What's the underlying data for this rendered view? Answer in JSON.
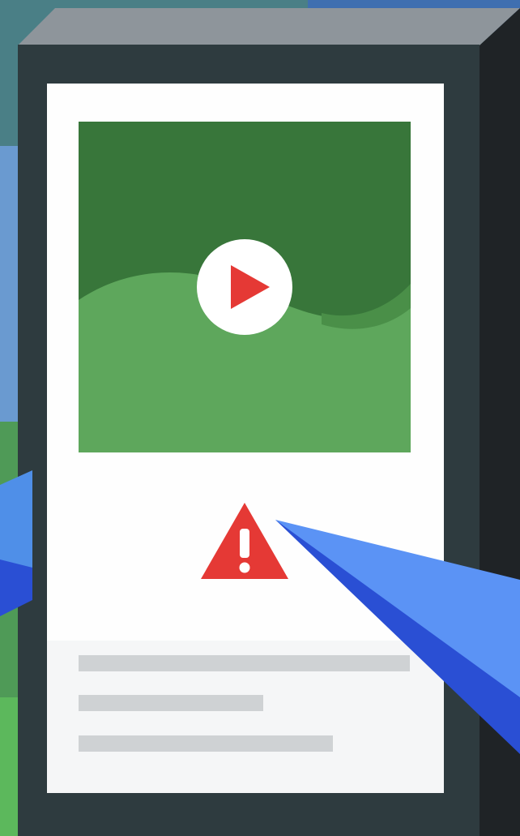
{
  "illustration": {
    "colors": {
      "background_blue": "#5b8fc9",
      "background_teal": "#4a8c7a",
      "background_green": "#5cb85c",
      "device_frame": "#2e3b3f",
      "device_side": "#1f2326",
      "device_top": "#8e959b",
      "screen": "#fefefe",
      "video_dark_green": "#38763a",
      "video_light_green": "#5ea75c",
      "play_triangle": "#e53935",
      "warning_red": "#e53935",
      "text_panel": "#f5f6f7",
      "text_line": "#cfd2d4",
      "pointer_light_blue": "#5b93f5",
      "pointer_dark_blue": "#2a4fd4"
    },
    "icons": {
      "play": "play-icon",
      "warning": "warning-icon"
    }
  }
}
